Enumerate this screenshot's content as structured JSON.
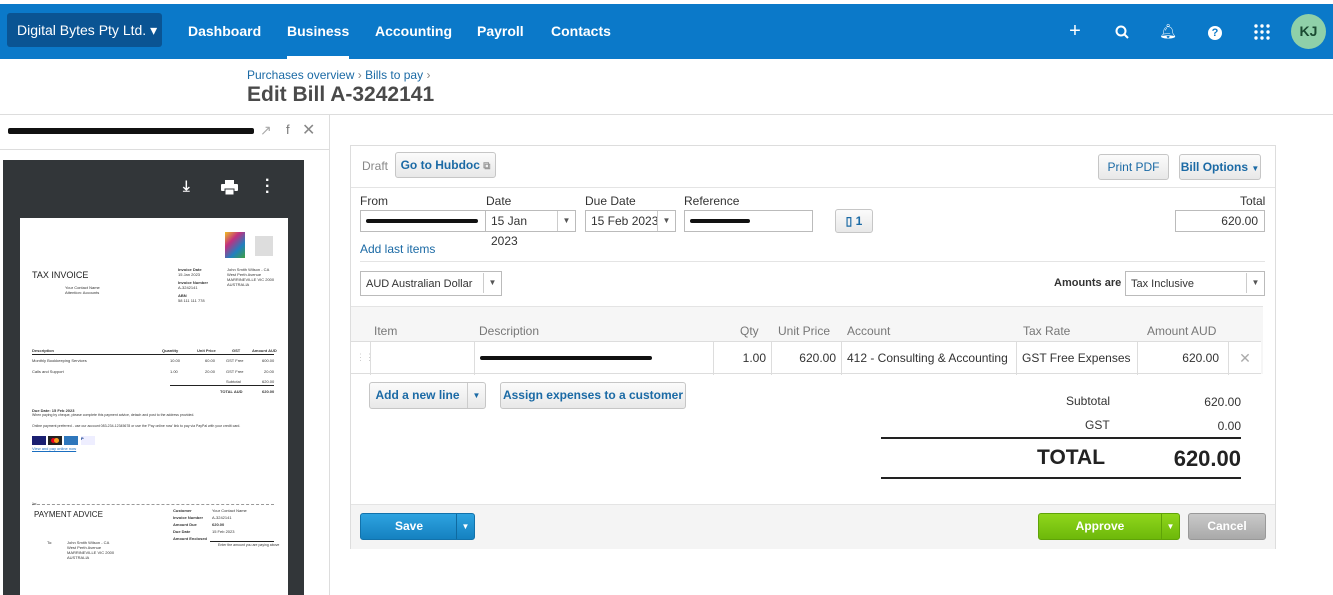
{
  "nav": {
    "org": "Digital Bytes Pty Ltd.",
    "items": [
      "Dashboard",
      "Business",
      "Accounting",
      "Payroll",
      "Contacts"
    ],
    "active": "Business",
    "avatar": "KJ",
    "icons": [
      "plus-icon",
      "search-icon",
      "bell-icon",
      "help-icon",
      "apps-grid-icon"
    ]
  },
  "breadcrumb": [
    "Purchases overview",
    "Bills to pay"
  ],
  "title": "Edit Bill A-3242141",
  "preview": {
    "invoice": {
      "heading": "TAX INVOICE",
      "contact": "Your Contact Name",
      "attention": "Attention: Accounts",
      "invoice_date_label": "Invoice Date",
      "invoice_date": "15 Jan 2023",
      "invoice_number_label": "Invoice Number",
      "invoice_number": "A-3242141",
      "abn_label": "ABN",
      "abn": "58 111 111 778",
      "address": [
        "John Smith Wilson - CA",
        "West Perth Avenue",
        "MARRINEVILLE VIC 2000",
        "AUSTRALIA"
      ],
      "columns": [
        "Description",
        "Quantity",
        "Unit Price",
        "GST",
        "Amount AUD"
      ],
      "rows": [
        [
          "Monthly Bookkeeping Services",
          "10.00",
          "60.00",
          "GST Free",
          "600.00"
        ],
        [
          "Calls and Support",
          "1.00",
          "20.00",
          "GST Free",
          "20.00"
        ]
      ],
      "subtotal_label": "Subtotal",
      "subtotal": "620.00",
      "total_label": "TOTAL AUD",
      "total": "620.00",
      "due": "Due Date: 15 Feb 2023",
      "due_text": "When paying by cheque, please complete this payment advice, detach and post to the address provided.",
      "online_text": "Online payment preferred - use our account 083-234-12345678 or use the 'Pay online now' link to pay via PayPal with your credit card.",
      "pay_link": "View and pay online now",
      "advice_heading": "PAYMENT ADVICE",
      "advice": [
        [
          "Customer",
          "Your Contact Name"
        ],
        [
          "Invoice Number",
          "A-3242141"
        ],
        [
          "Amount Due",
          "620.00"
        ],
        [
          "Due Date",
          "15 Feb 2023"
        ],
        [
          "Amount Enclosed",
          ""
        ]
      ],
      "enclosed_hint": "Enter the amount you are paying above",
      "to_label": "To:"
    }
  },
  "bill": {
    "status": "Draft",
    "hubdoc": "Go to Hubdoc",
    "print": "Print PDF",
    "options": "Bill Options",
    "labels": {
      "from": "From",
      "date": "Date",
      "due": "Due Date",
      "reference": "Reference",
      "total": "Total"
    },
    "date": "15 Jan 2023",
    "due_date": "15 Feb 2023",
    "attachments": "1",
    "total": "620.00",
    "add_last": "Add last items",
    "currency": "AUD Australian Dollar",
    "amounts_are_label": "Amounts are",
    "amounts_are": "Tax Inclusive",
    "columns": [
      "Item",
      "Description",
      "Qty",
      "Unit Price",
      "Account",
      "Tax Rate",
      "Amount AUD"
    ],
    "line": {
      "qty": "1.00",
      "unit_price": "620.00",
      "account": "412 - Consulting & Accounting",
      "tax_rate": "GST Free Expenses",
      "amount": "620.00"
    },
    "add_line": "Add a new line",
    "assign": "Assign expenses to a customer",
    "subtotal_label": "Subtotal",
    "subtotal": "620.00",
    "gst_label": "GST",
    "gst": "0.00",
    "total_label": "TOTAL",
    "grand_total": "620.00",
    "save": "Save",
    "approve": "Approve",
    "cancel": "Cancel"
  },
  "colors": {
    "nav": "#0b79c9",
    "approve": "#7ac70c",
    "save": "#1a8fd0"
  }
}
